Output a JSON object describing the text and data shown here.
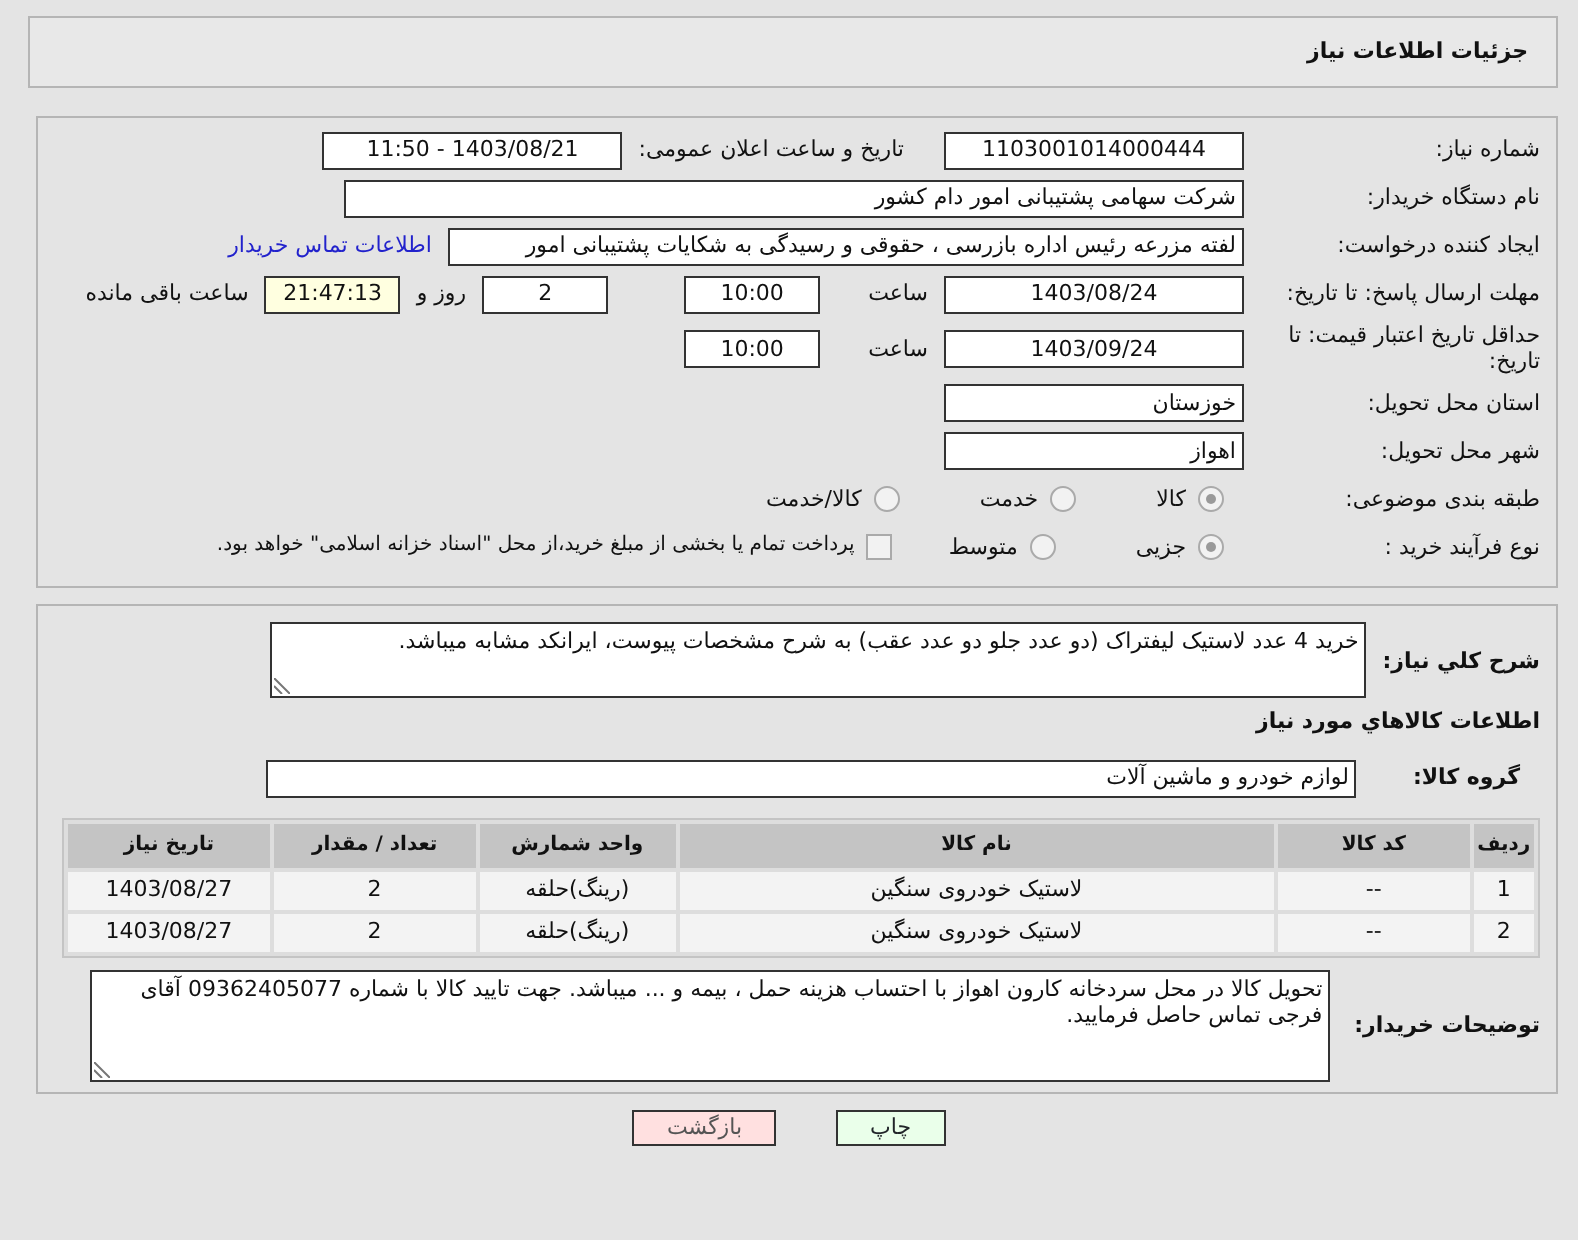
{
  "page_title": "جزئیات اطلاعات نیاز",
  "need_number": {
    "label": "شماره نیاز:",
    "value": "1103001014000444"
  },
  "announce": {
    "label": "تاریخ و ساعت اعلان عمومی:",
    "value": "1403/08/21 - 11:50"
  },
  "buyer": {
    "label": "نام دستگاه خریدار:",
    "value": "شرکت سهامی پشتیبانی امور دام کشور"
  },
  "requester": {
    "label": "ایجاد کننده درخواست:",
    "value": "لفته مزرعه رئیس اداره بازرسی ، حقوقی و رسیدگی به شکایات  پشتیبانی امور",
    "link": "اطلاعات تماس خریدار"
  },
  "reply_deadline": {
    "label": "مهلت ارسال پاسخ: تا تاریخ:",
    "date": "1403/08/24",
    "time_label": "ساعت",
    "time": "10:00",
    "days": "2",
    "days_label": "روز و",
    "remaining": "21:47:13",
    "remaining_label": "ساعت باقی مانده"
  },
  "price_validity": {
    "label": "حداقل تاریخ اعتبار قیمت: تا تاریخ:",
    "date": "1403/09/24",
    "time_label": "ساعت",
    "time": "10:00"
  },
  "province": {
    "label": "استان محل تحویل:",
    "value": "خوزستان"
  },
  "city": {
    "label": "شهر محل تحویل:",
    "value": "اهواز"
  },
  "category": {
    "label": "طبقه بندی موضوعی:",
    "options": [
      {
        "label": "کالا",
        "selected": true
      },
      {
        "label": "خدمت",
        "selected": false
      },
      {
        "label": "کالا/خدمت",
        "selected": false
      }
    ]
  },
  "process": {
    "label": "نوع فرآیند خرید :",
    "options": [
      {
        "label": "جزیی",
        "selected": true
      },
      {
        "label": "متوسط",
        "selected": false
      }
    ],
    "payment": {
      "checked": false,
      "text": "پرداخت تمام یا بخشی از مبلغ خرید،از محل \"اسناد خزانه اسلامی\" خواهد بود."
    }
  },
  "description": {
    "label": "شرح کلي نياز:",
    "value": "خرید 4 عدد لاستیک لیفتراک (دو عدد جلو دو عدد عقب) به شرح مشخصات پیوست، ایرانکد مشابه میباشد."
  },
  "goods_heading": "اطلاعات کالاهاي مورد نياز",
  "goods_group": {
    "label": "گروه کالا:",
    "value": "لوازم خودرو و ماشین آلات"
  },
  "table": {
    "columns": [
      "ردیف",
      "کد کالا",
      "نام کالا",
      "واحد شمارش",
      "تعداد / مقدار",
      "تاریخ نیاز"
    ],
    "rows": [
      [
        "1",
        "--",
        "لاستیک خودروی سنگین",
        "(رینگ)حلقه",
        "2",
        "1403/08/27"
      ],
      [
        "2",
        "--",
        "لاستیک خودروی سنگین",
        "(رینگ)حلقه",
        "2",
        "1403/08/27"
      ]
    ]
  },
  "notes": {
    "label": "توضیحات خریدار:",
    "value": "تحویل کالا در محل سردخانه کارون اهواز با احتساب هزینه حمل ، بیمه و ... میباشد. جهت تایید کالا با شماره 09362405077 آقای فرجی تماس حاصل فرمایید."
  },
  "buttons": [
    {
      "kind": "print",
      "label": "چاپ"
    },
    {
      "kind": "back",
      "label": "بازگشت"
    }
  ]
}
